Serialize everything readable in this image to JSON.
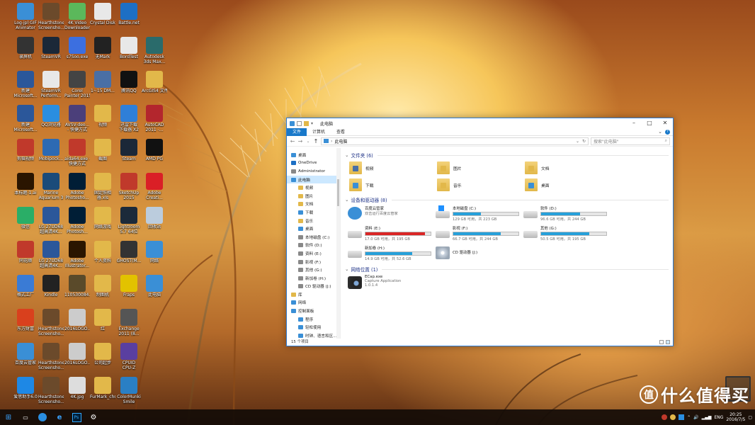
{
  "colors": {
    "accent": "#1979ca",
    "selection": "#cce8ff",
    "bar": "#26a0da",
    "bar_critical": "#da2626",
    "group_header": "#1e3287"
  },
  "desktop_icons": [
    {
      "label": "Log-jpl GIF\nAnimator",
      "icon": "globe-icon",
      "color": "#3a8fd6"
    },
    {
      "label": "Hearthstone\nScreensho...",
      "icon": "image-icon",
      "color": "#6b4a2b"
    },
    {
      "label": "4K Video\nDownloader",
      "icon": "download-icon",
      "color": "#5bb85b"
    },
    {
      "label": "Crystal Disk...",
      "icon": "file-icon",
      "color": "#e8e8e8"
    },
    {
      "label": "Battle.net",
      "icon": "battlenet-icon",
      "color": "#1d6fc4"
    },
    {
      "label": "录屏机",
      "icon": "camera-icon",
      "color": "#333"
    },
    {
      "label": "SteamVR",
      "icon": "vr-icon",
      "color": "#1b2838"
    },
    {
      "label": "s7Soo.exe",
      "icon": "app-icon",
      "color": "#3c6fe0"
    },
    {
      "label": "无Mark",
      "icon": "app-icon",
      "color": "#222"
    },
    {
      "label": "BordTest",
      "icon": "file-icon",
      "color": "#e8e8e8"
    },
    {
      "label": "Autodesk\n3ds Max...",
      "icon": "3dsmax-icon",
      "color": "#2a6b6b"
    },
    {
      "label": "新建\nMicrosoft...",
      "icon": "word-icon",
      "color": "#2b579a"
    },
    {
      "label": "SteamVR\nPerform...",
      "icon": "file-icon",
      "color": "#e8e8e8"
    },
    {
      "label": "Corel\nPainter 2015",
      "icon": "brush-icon",
      "color": "#444"
    },
    {
      "label": "1~15 DM...",
      "icon": "image-icon",
      "color": "#4a6fa5"
    },
    {
      "label": "腾讯QQ",
      "icon": "qq-icon",
      "color": "#111"
    },
    {
      "label": "ArcGIS4 文件",
      "icon": "folder-icon",
      "color": "#e2b84a"
    },
    {
      "label": "新建\nMicrosoft...",
      "icon": "word-icon",
      "color": "#2b579a"
    },
    {
      "label": "QQ浏览器",
      "icon": "browser-icon",
      "color": "#2a8ee0"
    },
    {
      "label": "AVSV-deo...\n- 快捷方式",
      "icon": "video-icon",
      "color": "#4b3f7a"
    },
    {
      "label": "视频",
      "icon": "folder-icon",
      "color": "#e2b84a"
    },
    {
      "label": "迅雷下载\n下载器 X2",
      "icon": "app-icon",
      "color": "#2f7fd8"
    },
    {
      "label": "AutoCAD\n2011 -...",
      "icon": "autocad-icon",
      "color": "#b3262d"
    },
    {
      "label": "剪辑视频",
      "icon": "app-icon",
      "color": "#c0392b"
    },
    {
      "label": "Mobipock...",
      "icon": "app-icon",
      "color": "#2d6ab3"
    },
    {
      "label": "aida64.exe -\n快捷方式",
      "icon": "aida-icon",
      "color": "#c0392b"
    },
    {
      "label": "截图",
      "icon": "folder-icon",
      "color": "#e2b84a"
    },
    {
      "label": "Steam",
      "icon": "steam-icon",
      "color": "#1b2838"
    },
    {
      "label": "AMD PG",
      "icon": "amd-icon",
      "color": "#111"
    },
    {
      "label": "本标题-1.ai",
      "icon": "ai-icon",
      "color": "#2a1500"
    },
    {
      "label": "Marine\nAquarium 3",
      "icon": "fish-icon",
      "color": "#1b4b7a"
    },
    {
      "label": "Adobe\nPhotosho...",
      "icon": "photoshop-icon",
      "color": "#001e36"
    },
    {
      "label": "固定照相\n器.xls",
      "icon": "folder-icon",
      "color": "#e2b84a"
    },
    {
      "label": "SketchUp\n2015",
      "icon": "sketchup-icon",
      "color": "#c0392b"
    },
    {
      "label": "Adobe\nCreati...",
      "icon": "cc-icon",
      "color": "#da1f26"
    },
    {
      "label": "微信",
      "icon": "wechat-icon",
      "color": "#2aae67"
    },
    {
      "label": "LG 27UD68\n超高清4K...",
      "icon": "word-icon",
      "color": "#2b579a"
    },
    {
      "label": "Adobe\nPhotosh...",
      "icon": "photoshop-icon",
      "color": "#001e36"
    },
    {
      "label": "网络游戏",
      "icon": "folder-icon",
      "color": "#e2b84a"
    },
    {
      "label": "Lightroom\n5.7 64位",
      "icon": "lightroom-icon",
      "color": "#1c2a3a"
    },
    {
      "label": "回收站",
      "icon": "recycle-icon",
      "color": "#bcd"
    },
    {
      "label": "同花顺",
      "icon": "app-icon",
      "color": "#c0392b"
    },
    {
      "label": "LG 27UD68\n超高清4K...",
      "icon": "word-icon",
      "color": "#2b579a"
    },
    {
      "label": "Adobe\nIllustrator...",
      "icon": "ai-icon",
      "color": "#2a1500"
    },
    {
      "label": "个人资料",
      "icon": "folder-icon",
      "color": "#e2b84a"
    },
    {
      "label": "GHOST(M...",
      "icon": "ghost-icon",
      "color": "#333"
    },
    {
      "label": "网络",
      "icon": "network-icon",
      "color": "#3a8fd6"
    },
    {
      "label": "格式工厂",
      "icon": "app-icon",
      "color": "#3a7bd5"
    },
    {
      "label": "Kindle",
      "icon": "kindle-icon",
      "color": "#222"
    },
    {
      "label": "110530084...",
      "icon": "image-icon",
      "color": "#5a4a2a"
    },
    {
      "label": "制图机",
      "icon": "folder-icon",
      "color": "#e2b84a"
    },
    {
      "label": "Fraps",
      "icon": "fraps-icon",
      "color": "#e2c200"
    },
    {
      "label": "此电脑",
      "icon": "computer-icon",
      "color": "#3a8fd6"
    },
    {
      "label": "东方财富",
      "icon": "app-icon",
      "color": "#d9401d"
    },
    {
      "label": "Hearthstone\nScreensho...",
      "icon": "image-icon",
      "color": "#6b4a2b"
    },
    {
      "label": "2016LOGO...",
      "icon": "image-icon",
      "color": "#ccc"
    },
    {
      "label": "红",
      "icon": "folder-icon",
      "color": "#e2b84a"
    },
    {
      "label": "Exchange\n2011 (8...",
      "icon": "app-icon",
      "color": "#555"
    },
    {
      "label": "百度云管家",
      "icon": "cloud-icon",
      "color": "#3a8fd6"
    },
    {
      "label": "Hearthstone\nScreensho...",
      "icon": "image-icon",
      "color": "#6b4a2b"
    },
    {
      "label": "2016LOGO...",
      "icon": "image-icon",
      "color": "#ccc"
    },
    {
      "label": "公司起步",
      "icon": "folder-icon",
      "color": "#e2b84a"
    },
    {
      "label": "CPUID\nCPU-Z",
      "icon": "cpuz-icon",
      "color": "#5a3fa0"
    },
    {
      "label": "爱思助手6.0",
      "icon": "app-icon",
      "color": "#1e88e5"
    },
    {
      "label": "Hearthstone\nScreensho...",
      "icon": "image-icon",
      "color": "#6b4a2b"
    },
    {
      "label": "4K.jpg",
      "icon": "image-icon",
      "color": "#ddd"
    },
    {
      "label": "FurMark_chs",
      "icon": "folder-icon",
      "color": "#e2b84a"
    },
    {
      "label": "ColorMunki\nSmile",
      "icon": "app-icon",
      "color": "#2a7fc4"
    }
  ],
  "window": {
    "title": "此电脑",
    "tabs": [
      "文件",
      "计算机",
      "查看"
    ],
    "address": "此电脑",
    "search_placeholder": "搜索\"此电脑\"",
    "nav": [
      {
        "label": "桌面",
        "indent": 0,
        "color": "#3a8fd6"
      },
      {
        "label": "OneDrive",
        "indent": 0,
        "color": "#1d6fc4"
      },
      {
        "label": "Administrator",
        "indent": 0,
        "color": "#888"
      },
      {
        "label": "此电脑",
        "indent": 0,
        "color": "#3a8fd6",
        "selected": true
      },
      {
        "label": "视频",
        "indent": 1,
        "color": "#e2b84a"
      },
      {
        "label": "图片",
        "indent": 1,
        "color": "#e2b84a"
      },
      {
        "label": "文档",
        "indent": 1,
        "color": "#e2b84a"
      },
      {
        "label": "下载",
        "indent": 1,
        "color": "#3a8fd6"
      },
      {
        "label": "音乐",
        "indent": 1,
        "color": "#e2b84a"
      },
      {
        "label": "桌面",
        "indent": 1,
        "color": "#3a8fd6"
      },
      {
        "label": "本地磁盘 (C:)",
        "indent": 1,
        "color": "#888"
      },
      {
        "label": "软件 (D:)",
        "indent": 1,
        "color": "#888"
      },
      {
        "label": "资料 (E:)",
        "indent": 1,
        "color": "#888"
      },
      {
        "label": "影视 (F:)",
        "indent": 1,
        "color": "#888"
      },
      {
        "label": "其他 (G:)",
        "indent": 1,
        "color": "#888"
      },
      {
        "label": "新加卷 (H:)",
        "indent": 1,
        "color": "#888"
      },
      {
        "label": "CD 驱动器 (J:)",
        "indent": 1,
        "color": "#888"
      },
      {
        "label": "库",
        "indent": 0,
        "color": "#e2b84a"
      },
      {
        "label": "网络",
        "indent": 0,
        "color": "#3a8fd6"
      },
      {
        "label": "控制面板",
        "indent": 0,
        "color": "#3a8fd6"
      },
      {
        "label": "程序",
        "indent": 1,
        "color": "#3a8fd6"
      },
      {
        "label": "轻松使用",
        "indent": 1,
        "color": "#3a8fd6"
      },
      {
        "label": "时钟、语言和区...",
        "indent": 1,
        "color": "#3a8fd6"
      }
    ],
    "folders_header": "文件夹 (6)",
    "folders": [
      {
        "label": "视频",
        "icon": "video-folder-icon"
      },
      {
        "label": "图片",
        "icon": "pictures-folder-icon"
      },
      {
        "label": "文档",
        "icon": "documents-folder-icon"
      },
      {
        "label": "下载",
        "icon": "downloads-folder-icon"
      },
      {
        "label": "音乐",
        "icon": "music-folder-icon"
      },
      {
        "label": "桌面",
        "icon": "desktop-folder-icon"
      }
    ],
    "drives_header": "设备和驱动器 (8)",
    "drives": [
      {
        "name": "百度云管家",
        "sub": "双击运行百度云管家",
        "kind": "app",
        "icon": "baidu-cloud-icon"
      },
      {
        "name": "本地磁盘 (C:)",
        "free": "129 GB 可用，共 223 GB",
        "used": 0.42,
        "icon": "windows-drive-icon"
      },
      {
        "name": "软件 (D:)",
        "free": "96.6 GB 可用，共 244 GB",
        "used": 0.6,
        "icon": "drive-icon"
      },
      {
        "name": "资料 (E:)",
        "free": "17.0 GB 可用，共 195 GB",
        "used": 0.91,
        "critical": true,
        "icon": "drive-icon"
      },
      {
        "name": "影视 (F:)",
        "free": "66.7 GB 可用，共 244 GB",
        "used": 0.73,
        "icon": "drive-icon"
      },
      {
        "name": "其他 (G:)",
        "free": "50.5 GB 可用，共 195 GB",
        "used": 0.74,
        "icon": "drive-icon"
      },
      {
        "name": "新加卷 (H:)",
        "free": "14.9 GB 可用，共 52.6 GB",
        "used": 0.72,
        "icon": "drive-icon"
      },
      {
        "name": "CD 驱动器 (J:)",
        "kind": "cd",
        "icon": "cd-drive-icon"
      }
    ],
    "network_header": "网络位置 (1)",
    "network": [
      {
        "name": "ECap.exe",
        "sub1": "Capture Application",
        "sub2": "1.0.1.4",
        "icon": "camera-icon"
      }
    ],
    "status": "15 个项目"
  },
  "taskbar": {
    "items": [
      "start-icon",
      "task-view-icon",
      "qq-browser-icon",
      "edge-icon",
      "photoshop-icon",
      "settings-icon"
    ],
    "time": "20:25",
    "date": "2016/7/5",
    "lang": "ENG"
  },
  "watermark": {
    "badge": "值",
    "text": "什么值得买"
  }
}
